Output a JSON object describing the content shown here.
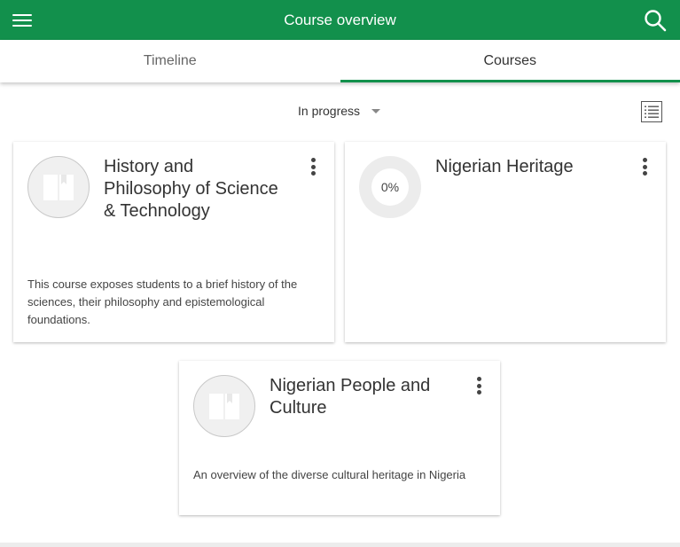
{
  "appbar": {
    "title": "Course overview"
  },
  "tabs": [
    {
      "label": "Timeline",
      "active": false
    },
    {
      "label": "Courses",
      "active": true
    }
  ],
  "filter": {
    "selected": "In progress"
  },
  "courses": [
    {
      "name": "History and Philosophy of Science & Technology",
      "description": "This course exposes students to a brief history of the sciences, their philosophy and epistemological foundations.",
      "image": "book-icon"
    },
    {
      "name": "Nigerian Heritage",
      "progress": "0%"
    },
    {
      "name": "Nigerian People and Culture",
      "description": "An overview of the diverse cultural heritage in Nigeria",
      "image": "book-icon"
    }
  ],
  "colors": {
    "brand": "#12904c",
    "tab_indicator": "#12904c"
  }
}
